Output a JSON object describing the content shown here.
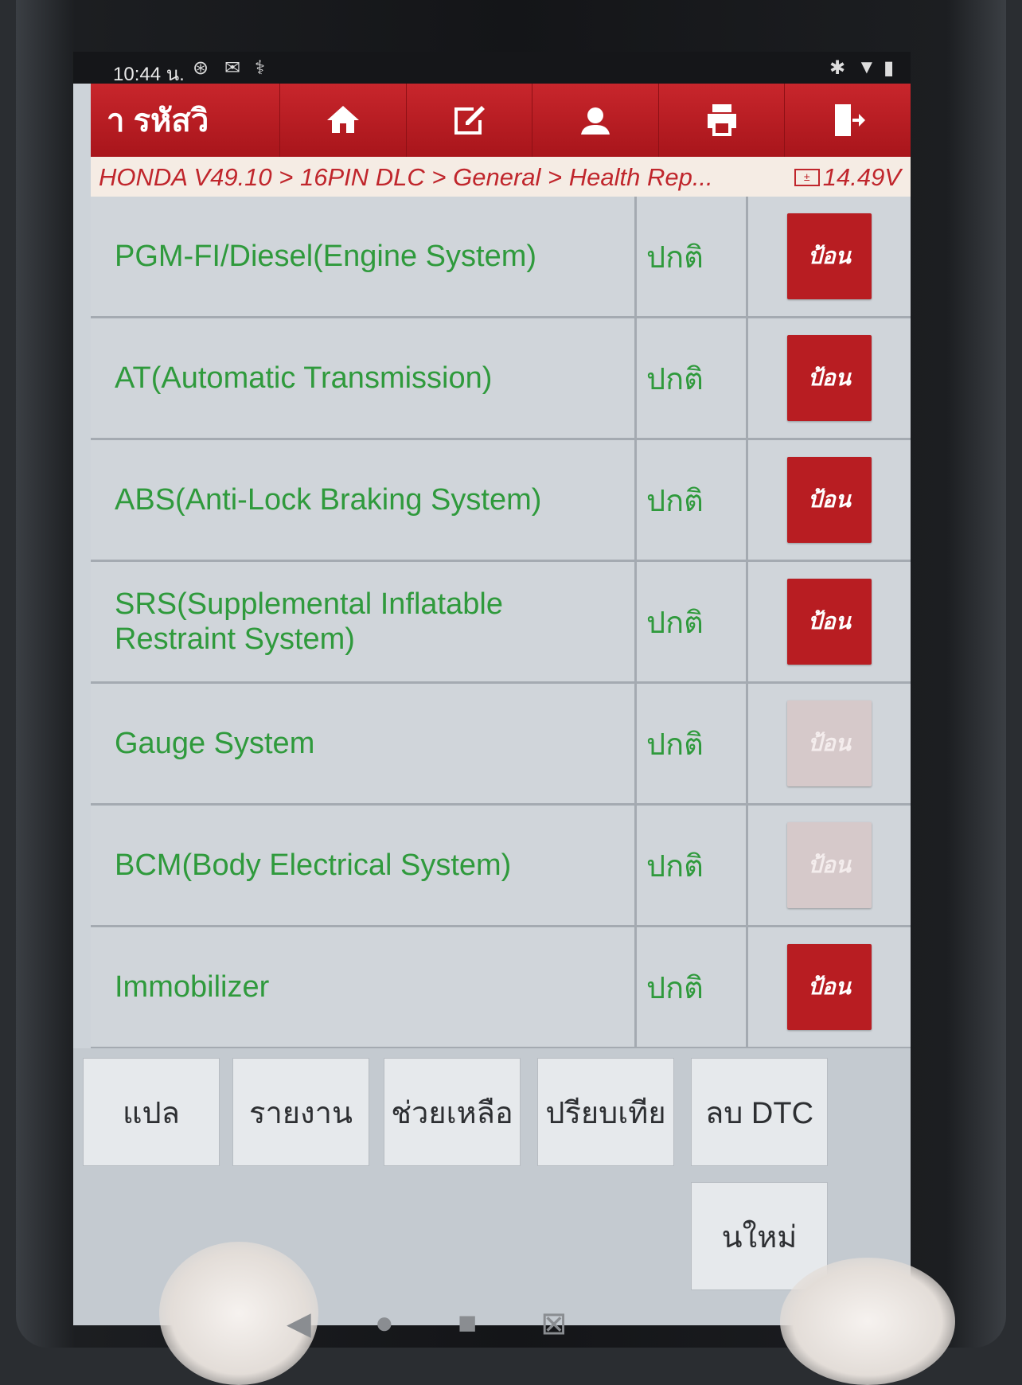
{
  "status_bar": {
    "time": "10:44 น."
  },
  "toolbar": {
    "title": "า รหัสวิ"
  },
  "breadcrumb": {
    "path": "HONDA V49.10 > 16PIN DLC > General > Health Rep...",
    "voltage": "14.49V"
  },
  "table": {
    "rows": [
      {
        "name": "PGM-FI/Diesel(Engine System)",
        "status": "ปกติ",
        "action": "ป้อน"
      },
      {
        "name": "AT(Automatic Transmission)",
        "status": "ปกติ",
        "action": "ป้อน"
      },
      {
        "name": "ABS(Anti-Lock Braking System)",
        "status": "ปกติ",
        "action": "ป้อน"
      },
      {
        "name": "SRS(Supplemental Inflatable Restraint System)",
        "status": "ปกติ",
        "action": "ป้อน"
      },
      {
        "name": "Gauge System",
        "status": "ปกติ",
        "action": "ป้อน"
      },
      {
        "name": "BCM(Body Electrical System)",
        "status": "ปกติ",
        "action": "ป้อน"
      },
      {
        "name": "Immobilizer",
        "status": "ปกติ",
        "action": "ป้อน"
      }
    ]
  },
  "bottom_buttons": {
    "translate": "แปล",
    "report": "รายงาน",
    "help": "ช่วยเหลือ",
    "compare": "ปรียบเทีย",
    "clear_dtc": "ลบ DTC",
    "new": "นใหม่"
  }
}
